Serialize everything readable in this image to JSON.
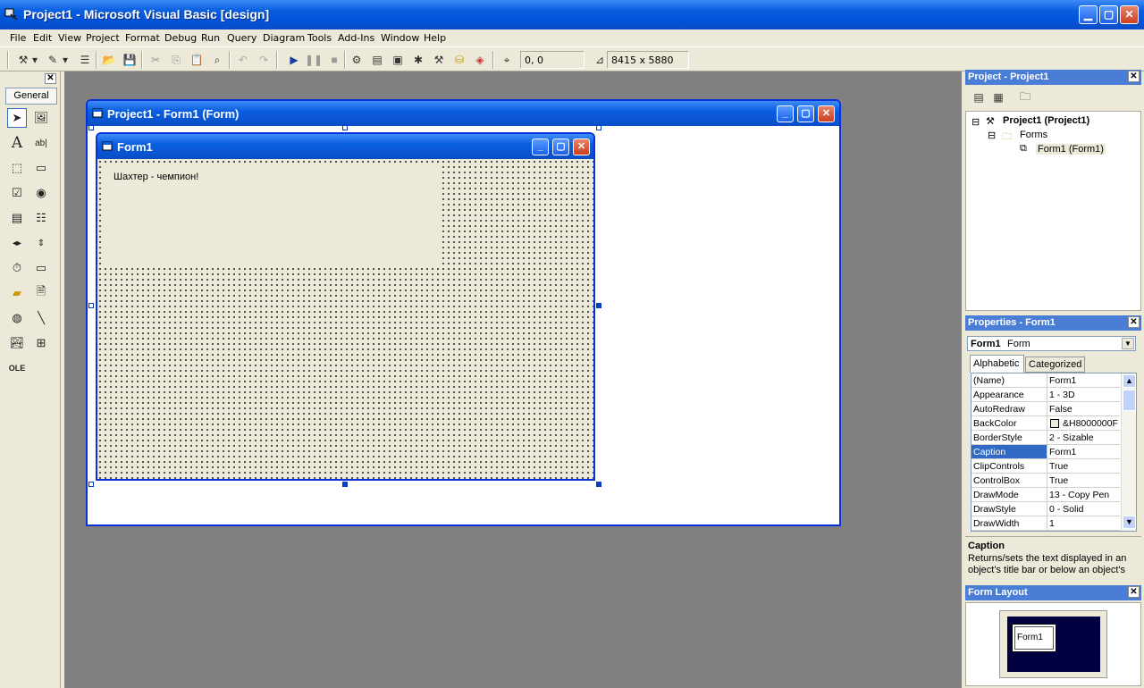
{
  "window": {
    "title": "Project1 - Microsoft Visual Basic [design]"
  },
  "menu": [
    "File",
    "Edit",
    "View",
    "Project",
    "Format",
    "Debug",
    "Run",
    "Query",
    "Diagram",
    "Tools",
    "Add-Ins",
    "Window",
    "Help"
  ],
  "toolbar": {
    "position": "0, 0",
    "size": "8415 x 5880"
  },
  "toolbox": {
    "tab_label": "General"
  },
  "designer": {
    "title": "Project1 - Form1 (Form)"
  },
  "form": {
    "caption": "Form1",
    "label_text": "Шахтер - чемпион!"
  },
  "project_explorer": {
    "title": "Project - Project1",
    "root": "Project1 (Project1)",
    "folder": "Forms",
    "item": "Form1 (Form1)"
  },
  "properties": {
    "title": "Properties - Form1",
    "object_name": "Form1",
    "object_type": "Form",
    "tabs": [
      "Alphabetic",
      "Categorized"
    ],
    "rows": [
      {
        "name": "(Name)",
        "value": "Form1"
      },
      {
        "name": "Appearance",
        "value": "1 - 3D"
      },
      {
        "name": "AutoRedraw",
        "value": "False"
      },
      {
        "name": "BackColor",
        "value": "&H8000000F"
      },
      {
        "name": "BorderStyle",
        "value": "2 - Sizable"
      },
      {
        "name": "Caption",
        "value": "Form1"
      },
      {
        "name": "ClipControls",
        "value": "True"
      },
      {
        "name": "ControlBox",
        "value": "True"
      },
      {
        "name": "DrawMode",
        "value": "13 - Copy Pen"
      },
      {
        "name": "DrawStyle",
        "value": "0 - Solid"
      },
      {
        "name": "DrawWidth",
        "value": "1"
      }
    ],
    "desc_title": "Caption",
    "desc_text": "Returns/sets the text displayed in an object's title bar or below an object's"
  },
  "form_layout": {
    "title": "Form Layout",
    "preview_label": "Form1"
  }
}
